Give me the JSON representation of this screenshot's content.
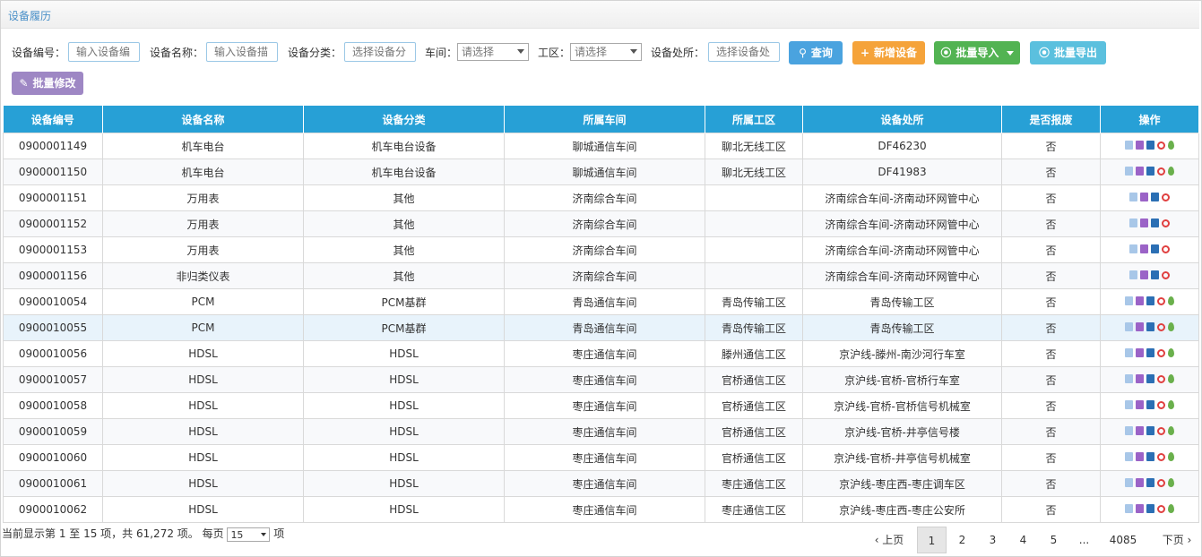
{
  "page_title": "设备履历",
  "filters": {
    "device_no_label": "设备编号：",
    "device_no_placeholder": "输入设备编",
    "device_name_label": "设备名称：",
    "device_name_placeholder": "输入设备描",
    "device_category_label": "设备分类：",
    "device_category_placeholder": "选择设备分",
    "workshop_label": "车间：",
    "workshop_value": "请选择",
    "work_area_label": "工区：",
    "work_area_value": "请选择",
    "location_label": "设备处所：",
    "location_placeholder": "选择设备处"
  },
  "buttons": {
    "query": "查询",
    "add": "新增设备",
    "batch_import": "批量导入",
    "batch_export": "批量导出",
    "batch_edit": "批量修改"
  },
  "table": {
    "headers": [
      "设备编号",
      "设备名称",
      "设备分类",
      "所属车间",
      "所属工区",
      "设备处所",
      "是否报废",
      "操作"
    ],
    "rows": [
      [
        "0900001149",
        "机车电台",
        "机车电台设备",
        "聊城通信车间",
        "聊北无线工区",
        "DF46230",
        "否"
      ],
      [
        "0900001150",
        "机车电台",
        "机车电台设备",
        "聊城通信车间",
        "聊北无线工区",
        "DF41983",
        "否"
      ],
      [
        "0900001151",
        "万用表",
        "其他",
        "济南综合车间",
        "",
        "济南综合车间-济南动环网管中心",
        "否"
      ],
      [
        "0900001152",
        "万用表",
        "其他",
        "济南综合车间",
        "",
        "济南综合车间-济南动环网管中心",
        "否"
      ],
      [
        "0900001153",
        "万用表",
        "其他",
        "济南综合车间",
        "",
        "济南综合车间-济南动环网管中心",
        "否"
      ],
      [
        "0900001156",
        "非归类仪表",
        "其他",
        "济南综合车间",
        "",
        "济南综合车间-济南动环网管中心",
        "否"
      ],
      [
        "0900010054",
        "PCM",
        "PCM基群",
        "青岛通信车间",
        "青岛传输工区",
        "青岛传输工区",
        "否"
      ],
      [
        "0900010055",
        "PCM",
        "PCM基群",
        "青岛通信车间",
        "青岛传输工区",
        "青岛传输工区",
        "否"
      ],
      [
        "0900010056",
        "HDSL",
        "HDSL",
        "枣庄通信车间",
        "滕州通信工区",
        "京沪线-滕州-南沙河行车室",
        "否"
      ],
      [
        "0900010057",
        "HDSL",
        "HDSL",
        "枣庄通信车间",
        "官桥通信工区",
        "京沪线-官桥-官桥行车室",
        "否"
      ],
      [
        "0900010058",
        "HDSL",
        "HDSL",
        "枣庄通信车间",
        "官桥通信工区",
        "京沪线-官桥-官桥信号机械室",
        "否"
      ],
      [
        "0900010059",
        "HDSL",
        "HDSL",
        "枣庄通信车间",
        "官桥通信工区",
        "京沪线-官桥-井亭信号楼",
        "否"
      ],
      [
        "0900010060",
        "HDSL",
        "HDSL",
        "枣庄通信车间",
        "官桥通信工区",
        "京沪线-官桥-井亭信号机械室",
        "否"
      ],
      [
        "0900010061",
        "HDSL",
        "HDSL",
        "枣庄通信车间",
        "枣庄通信工区",
        "京沪线-枣庄西-枣庄调车区",
        "否"
      ],
      [
        "0900010062",
        "HDSL",
        "HDSL",
        "枣庄通信车间",
        "枣庄通信工区",
        "京沪线-枣庄西-枣庄公安所",
        "否"
      ]
    ],
    "rows_with_pin": [
      0,
      1,
      6,
      7,
      8,
      9,
      10,
      11,
      12,
      13,
      14
    ],
    "highlighted_row": 7
  },
  "footer": {
    "info_prefix": "当前显示第 1 至 15 项，共 61,272 项。 每页",
    "page_size": "15",
    "info_suffix": "项"
  },
  "pagination": {
    "prev": "‹ 上页",
    "pages": [
      "1",
      "2",
      "3",
      "4",
      "5",
      "...",
      "4085"
    ],
    "next": "下页 ›",
    "active": "1"
  },
  "colors": {
    "header_bg": "#27a0d6",
    "query_btn": "#4aa3df",
    "add_btn": "#f5a33a",
    "import_btn": "#52b352",
    "export_btn": "#5bc0de",
    "edit_btn": "#9e87c4"
  },
  "icons": {
    "query": "search-icon",
    "add": "plus-icon",
    "import": "upload-circle-icon",
    "export": "download-circle-icon",
    "edit": "pencil-icon",
    "row_ops": [
      "edit-icon",
      "book-icon",
      "document-icon",
      "ban-icon",
      "map-pin-icon"
    ]
  }
}
